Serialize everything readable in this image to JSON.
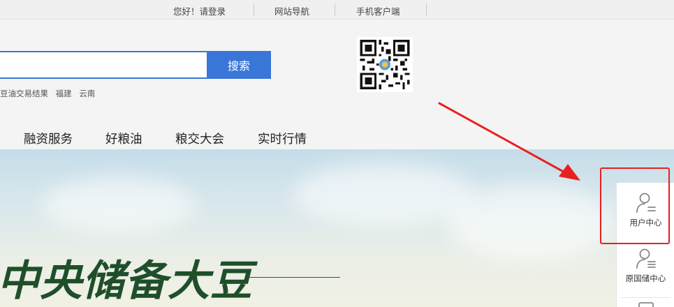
{
  "topbar": {
    "greeting": "您好！请登录",
    "site_nav": "网站导航",
    "mobile": "手机客户端"
  },
  "search": {
    "placeholder": "",
    "button": "搜索",
    "hotwords": [
      "豆油交易结果",
      "福建",
      "云南"
    ]
  },
  "nav": {
    "items": [
      "融资服务",
      "好粮油",
      "粮交大会",
      "实时行情"
    ]
  },
  "banner": {
    "title": "中央储备大豆"
  },
  "side_panel": {
    "items": [
      "用户中心",
      "原国储中心"
    ]
  },
  "colors": {
    "accent": "#3a76d8",
    "highlight": "#e8201f",
    "banner_text": "#1f4f2a"
  }
}
